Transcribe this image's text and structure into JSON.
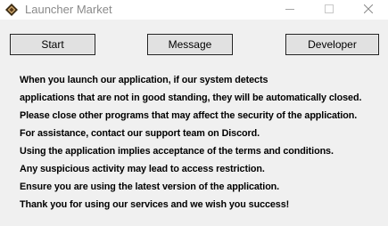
{
  "window": {
    "title": "Launcher Market",
    "icon": "diamond-logo-icon",
    "controls": {
      "minimize_icon": "minimize-icon",
      "maximize_icon": "maximize-icon",
      "close_icon": "close-icon"
    }
  },
  "buttons": {
    "start": "Start",
    "message": "Message",
    "developer": "Developer"
  },
  "message_lines": [
    "When you launch our application, if our system detects",
    "applications that are not in good standing, they will be automatically closed.",
    "Please close other programs that may affect the security of the application.",
    "For assistance, contact our support team on Discord.",
    "Using the application implies acceptance of the terms and conditions.",
    "Any suspicious activity may lead to access restriction.",
    "Ensure you are using the latest version of the application.",
    "Thank you for using our services and we wish you success!"
  ],
  "colors": {
    "background": "#f0f0f0",
    "titlebar": "#ffffff",
    "button_face": "#e1e1e1",
    "button_border": "#222222",
    "text": "#000000",
    "title_text": "#8a8a8a"
  }
}
